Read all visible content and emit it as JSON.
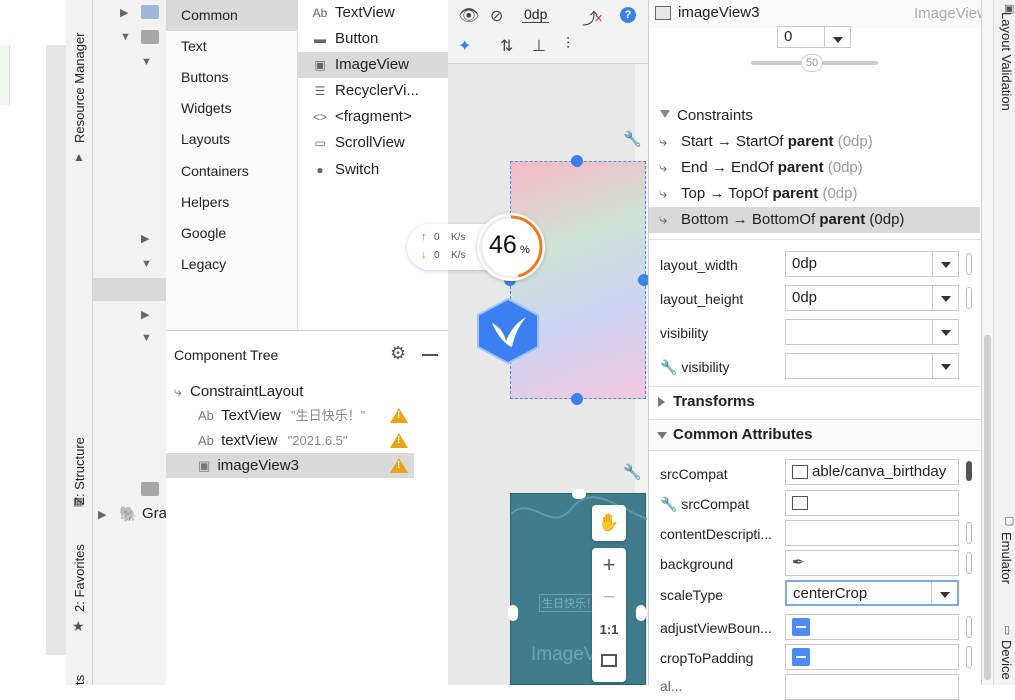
{
  "left_tabs": {
    "resource_manager": "Resource Manager",
    "structure": "Z: Structure",
    "favorites": "2: Favorites",
    "bottom_partial": "ts"
  },
  "project_tree": {
    "gradle_partial": "Gra"
  },
  "palette": {
    "categories": [
      "Common",
      "Text",
      "Buttons",
      "Widgets",
      "Layouts",
      "Containers",
      "Helpers",
      "Google",
      "Legacy"
    ],
    "items": [
      {
        "icon": "Ab",
        "label": "TextView"
      },
      {
        "icon": "▬",
        "label": "Button"
      },
      {
        "icon": "▣",
        "label": "ImageView"
      },
      {
        "icon": "☰",
        "label": "RecyclerVi..."
      },
      {
        "icon": "<>",
        "label": "<fragment>"
      },
      {
        "icon": "▭",
        "label": "ScrollView"
      },
      {
        "icon": "●",
        "label": "Switch"
      }
    ]
  },
  "component_tree": {
    "title": "Component Tree",
    "root": "ConstraintLayout",
    "nodes": [
      {
        "icon": "Ab",
        "name": "TextView",
        "value": "\"生日快乐！\""
      },
      {
        "icon": "Ab",
        "name": "textView",
        "value": "\"2021.6.5\""
      },
      {
        "icon": "▣",
        "name": "imageView3",
        "value": ""
      }
    ]
  },
  "canvas": {
    "margin_value": "0dp",
    "speed_up": "0",
    "speed_down": "0",
    "speed_unit": "K/s",
    "percent": "46",
    "percent_sign": "%",
    "preview_text_small": "生日快乐！",
    "preview_text_big": "ImageV",
    "zoom_ratio": "1:1"
  },
  "attributes": {
    "header_name": "imageView3",
    "header_type": "ImageView",
    "bias_value": "0",
    "slider_value": "50",
    "constraints_title": "Constraints",
    "constraints": [
      {
        "prefix": "Start → StartOf ",
        "bold": "parent",
        "suffix": " (0dp)"
      },
      {
        "prefix": "End → EndOf ",
        "bold": "parent",
        "suffix": " (0dp)"
      },
      {
        "prefix": "Top → TopOf ",
        "bold": "parent",
        "suffix": " (0dp)"
      },
      {
        "prefix": "Bottom → BottomOf ",
        "bold": "parent",
        "suffix": " (0dp)"
      }
    ],
    "layout_width_label": "layout_width",
    "layout_width_value": "0dp",
    "layout_height_label": "layout_height",
    "layout_height_value": "0dp",
    "visibility_label": "visibility",
    "tools_visibility_label": "visibility",
    "transforms_title": "Transforms",
    "common_title": "Common Attributes",
    "src_compat_label": "srcCompat",
    "src_compat_value": "able/canva_birthday",
    "tools_src_compat_label": "srcCompat",
    "content_desc_label": "contentDescripti...",
    "background_label": "background",
    "scale_type_label": "scaleType",
    "scale_type_value": "centerCrop",
    "adjust_label": "adjustViewBoun...",
    "crop_label": "cropToPadding",
    "cut_label": "al..."
  },
  "right_tabs": {
    "layout_validation": "Layout Validation",
    "emulator": "Emulator",
    "device": "Device"
  },
  "colors": {
    "accent": "#4a8cf0",
    "warning": "#e8a317",
    "progress": "#f07820",
    "selection": "#d9d9d9"
  }
}
